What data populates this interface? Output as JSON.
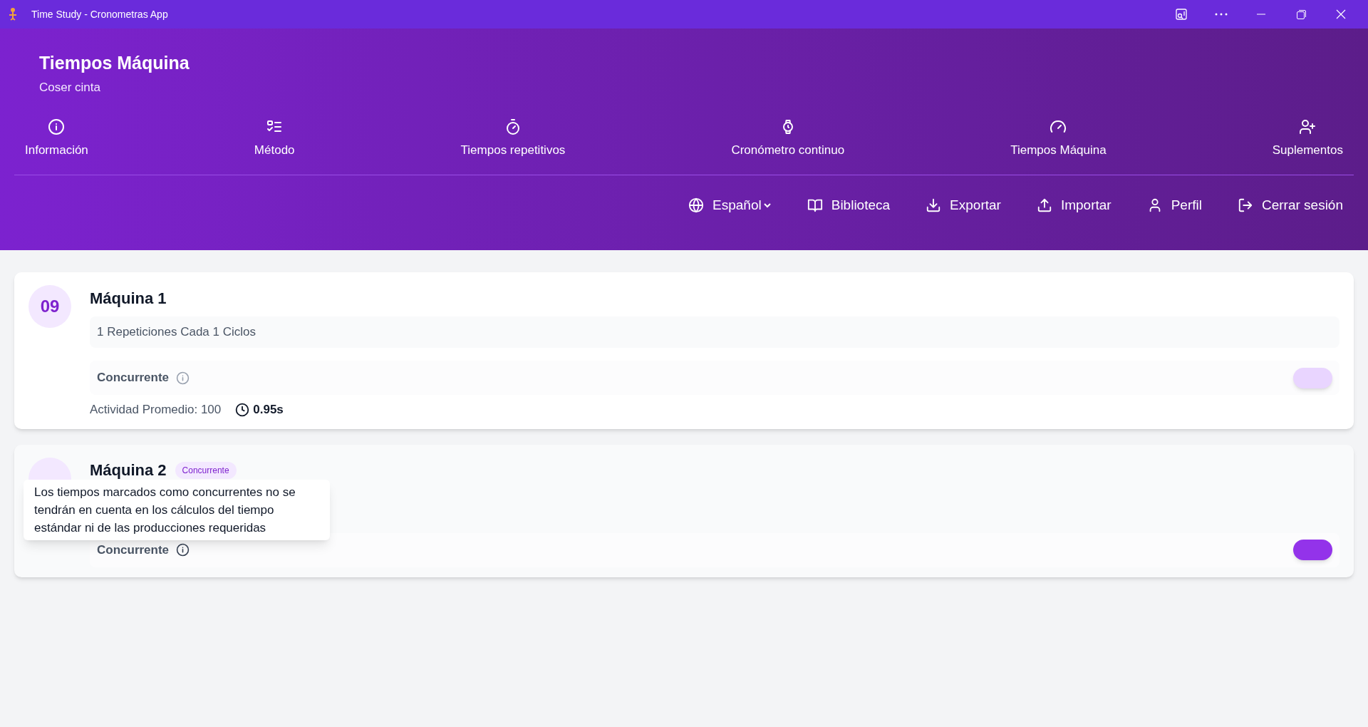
{
  "window": {
    "title": "Time Study - Cronometras App"
  },
  "header": {
    "title": "Tiempos Máquina",
    "subtitle": "Coser cinta"
  },
  "nav": [
    {
      "label": "Información"
    },
    {
      "label": "Método"
    },
    {
      "label": "Tiempos repetitivos"
    },
    {
      "label": "Cronómetro continuo"
    },
    {
      "label": "Tiempos Máquina"
    },
    {
      "label": "Suplementos"
    }
  ],
  "actions": [
    {
      "label": "Español",
      "kind": "dropdown"
    },
    {
      "label": "Biblioteca",
      "kind": "button"
    },
    {
      "label": "Exportar",
      "kind": "button"
    },
    {
      "label": "Importar",
      "kind": "button"
    },
    {
      "label": "Perfil",
      "kind": "button"
    },
    {
      "label": "Cerrar sesión",
      "kind": "button"
    }
  ],
  "machines": [
    {
      "number": "09",
      "name": "Máquina 1",
      "schedule": "1 Repeticiones Cada 1 Ciclos",
      "concurrent_label": "Concurrente",
      "concurrent": false,
      "activity": "Actividad Promedio: 100",
      "time": "0.95s"
    },
    {
      "name": "Máquina 2",
      "tag": "Concurrente",
      "concurrent_label": "Concurrente",
      "concurrent": true
    }
  ],
  "tooltip": {
    "text": "Los tiempos marcados como concurrentes no se tendrán en cuenta en los cálculos del tiempo estándar ni de las producciones requeridas"
  }
}
